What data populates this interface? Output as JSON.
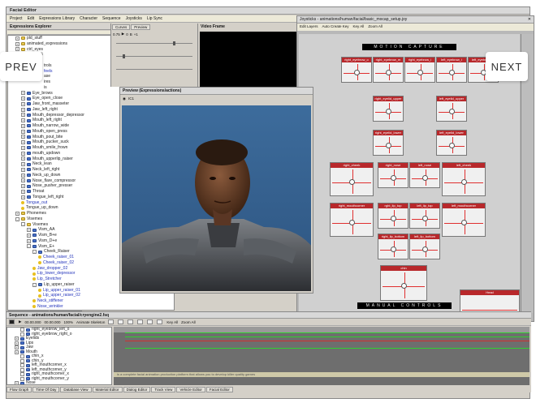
{
  "app": {
    "title": "Facial Editor",
    "menu": [
      "Project",
      "Edit",
      "Expressions Library",
      "Character",
      "Sequence",
      "Joysticks",
      "Lip Sync"
    ]
  },
  "explorer": {
    "title": "Expressions Explorer",
    "rows": [
      {
        "label": "pld_stuff",
        "indent": 1,
        "icon": "folder",
        "box": "+"
      },
      {
        "label": "animated_expressions",
        "indent": 1,
        "icon": "folder",
        "box": "+"
      },
      {
        "label": "ctrl_eyes",
        "indent": 1,
        "icon": "folder",
        "box": "+"
      },
      {
        "label": "ctrl_neck",
        "indent": 1,
        "icon": "folder",
        "box": "+"
      },
      {
        "label": "",
        "indent": 1,
        "icon": "none",
        "box": ""
      },
      {
        "label": "trols",
        "indent": 6,
        "icon": "none",
        "box": ""
      },
      {
        "label": "feels",
        "indent": 6,
        "icon": "none",
        "box": "",
        "link": true
      },
      {
        "label": "ase",
        "indent": 6,
        "icon": "none",
        "box": ""
      },
      {
        "label": "ires",
        "indent": 6,
        "icon": "none",
        "box": ""
      },
      {
        "label": "is",
        "indent": 6,
        "icon": "none",
        "box": ""
      },
      {
        "label": "Eye_brows",
        "indent": 2,
        "icon": "blue",
        "box": "+"
      },
      {
        "label": "Eye_open_close",
        "indent": 2,
        "icon": "blue",
        "box": "+"
      },
      {
        "label": "Jaw_front_masseter",
        "indent": 2,
        "icon": "blue",
        "box": "+"
      },
      {
        "label": "Jaw_left_right",
        "indent": 2,
        "icon": "blue",
        "box": "+"
      },
      {
        "label": "Mouth_depressor_depressor",
        "indent": 2,
        "icon": "blue",
        "box": "+"
      },
      {
        "label": "Mouth_left_right",
        "indent": 2,
        "icon": "blue",
        "box": "+"
      },
      {
        "label": "Mouth_narrow_wide",
        "indent": 2,
        "icon": "blue",
        "box": "+"
      },
      {
        "label": "Mouth_open_press",
        "indent": 2,
        "icon": "blue",
        "box": "+"
      },
      {
        "label": "Mouth_pout_bite",
        "indent": 2,
        "icon": "blue",
        "box": "+"
      },
      {
        "label": "Mouth_pucker_suck",
        "indent": 2,
        "icon": "blue",
        "box": "+"
      },
      {
        "label": "Mouth_smile_frown",
        "indent": 2,
        "icon": "blue",
        "box": "+"
      },
      {
        "label": "mouth_updown",
        "indent": 2,
        "icon": "blue",
        "box": "+"
      },
      {
        "label": "Mouth_upperlip_raiser",
        "indent": 2,
        "icon": "blue",
        "box": "+"
      },
      {
        "label": "Neck_lean",
        "indent": 2,
        "icon": "blue",
        "box": "+"
      },
      {
        "label": "Neck_left_right",
        "indent": 2,
        "icon": "blue",
        "box": "+"
      },
      {
        "label": "Neck_up_down",
        "indent": 2,
        "icon": "blue",
        "box": "+"
      },
      {
        "label": "Nose_flare_compressor",
        "indent": 2,
        "icon": "blue",
        "box": "+"
      },
      {
        "label": "Nose_pusher_presser",
        "indent": 2,
        "icon": "blue",
        "box": "+"
      },
      {
        "label": "Throat",
        "indent": 2,
        "icon": "blue",
        "box": "+"
      },
      {
        "label": "Tongue_left_right",
        "indent": 2,
        "icon": "blue",
        "box": "+"
      },
      {
        "label": "Tongue_out",
        "indent": 2,
        "icon": "dot",
        "box": "",
        "link": true
      },
      {
        "label": "Tongue_up_down",
        "indent": 2,
        "icon": "dot",
        "box": ""
      },
      {
        "label": "Phonemes",
        "indent": 1,
        "icon": "folder",
        "box": "+"
      },
      {
        "label": "Visemes",
        "indent": 1,
        "icon": "folder",
        "box": "-"
      },
      {
        "label": "Visemes",
        "indent": 2,
        "icon": "folder",
        "box": "-"
      },
      {
        "label": "Vism_AA",
        "indent": 3,
        "icon": "blue",
        "box": "+"
      },
      {
        "label": "Vism_B+e",
        "indent": 3,
        "icon": "blue",
        "box": "+"
      },
      {
        "label": "Vism_D+e",
        "indent": 3,
        "icon": "blue",
        "box": "+"
      },
      {
        "label": "Vism_E+",
        "indent": 3,
        "icon": "blue",
        "box": "-"
      },
      {
        "label": "Cheek_Raiser",
        "indent": 4,
        "icon": "blue",
        "box": "-"
      },
      {
        "label": "Cheek_raiser_01",
        "indent": 5,
        "icon": "dot",
        "box": "",
        "link": true
      },
      {
        "label": "Cheek_raiser_02",
        "indent": 5,
        "icon": "dot",
        "box": "",
        "link": true
      },
      {
        "label": "Jaw_dropper_02",
        "indent": 4,
        "icon": "dot",
        "box": "",
        "link": true
      },
      {
        "label": "Lip_lower_depressor",
        "indent": 4,
        "icon": "dot",
        "box": "",
        "link": true
      },
      {
        "label": "Lip_Stretcher",
        "indent": 4,
        "icon": "dot",
        "box": "",
        "link": true
      },
      {
        "label": "Lip_upper_raiser",
        "indent": 4,
        "icon": "blue",
        "box": "-"
      },
      {
        "label": "Lip_upper_raiser_01",
        "indent": 5,
        "icon": "dot",
        "box": "",
        "link": true
      },
      {
        "label": "Lip_upper_raiser_02",
        "indent": 5,
        "icon": "dot",
        "box": "",
        "link": true
      },
      {
        "label": "Neck_stiffener",
        "indent": 4,
        "icon": "dot",
        "box": "",
        "link": true
      },
      {
        "label": "Nose_wrinkler",
        "indent": 4,
        "icon": "dot",
        "box": "",
        "link": true
      },
      {
        "label": "Vism_F+V",
        "indent": 3,
        "icon": "blue",
        "box": "-"
      },
      {
        "label": "Fanial_drum",
        "indent": 4,
        "icon": "dot",
        "box": "",
        "link": true
      }
    ],
    "tabs": [
      "Expressions Explorer",
      "Effectors Sliders"
    ]
  },
  "curves": {
    "tabs": [
      "Curves",
      "Preview"
    ],
    "value": "0.75",
    "toolbar_buttons": [
      "0",
      "B",
      "+1"
    ]
  },
  "video": {
    "title": "Video Frame"
  },
  "preview": {
    "title": "Preview (Expressions/actions)",
    "toolbar": "IC1"
  },
  "joysticks": {
    "title": "Joysticks - animations/human/facial/basic_mocap_setup.joy",
    "menu": [
      "Edit Layers",
      "Auto Create Key",
      "Key All",
      "Zoom All"
    ],
    "motion_capture_label": "MOTION CAPTURE",
    "manual_controls_label": "MANUAL CONTROLS",
    "controls": [
      {
        "name": "right_eyebrow_o",
        "col": 0,
        "row": 0,
        "size": "s"
      },
      {
        "name": "right_eyebrow_m",
        "col": 1,
        "row": 0,
        "size": "s"
      },
      {
        "name": "right_eyebrow_i",
        "col": 2,
        "row": 0,
        "size": "s"
      },
      {
        "name": "left_eyebrow_i",
        "col": 3,
        "row": 0,
        "size": "s"
      },
      {
        "name": "left_eyebrow_m",
        "col": 4,
        "row": 0,
        "size": "s"
      },
      {
        "name": "right_eyelid_upper",
        "col": 1,
        "row": 1,
        "size": "s"
      },
      {
        "name": "left_eyelid_upper",
        "col": 3,
        "row": 1,
        "size": "s"
      },
      {
        "name": "right_eyelid_lower",
        "col": 1,
        "row": 2,
        "size": "s"
      },
      {
        "name": "left_eyelid_lower",
        "col": 3,
        "row": 2,
        "size": "s"
      },
      {
        "name": "right_cheek",
        "col": 0,
        "row": 3,
        "size": "l"
      },
      {
        "name": "right_nose",
        "col": 1,
        "row": 3,
        "size": "s"
      },
      {
        "name": "left_nose",
        "col": 2,
        "row": 3,
        "size": "s"
      },
      {
        "name": "left_cheek",
        "col": 3,
        "row": 3,
        "size": "l"
      },
      {
        "name": "rght_lip_top",
        "col": 1,
        "row": 4,
        "size": "s"
      },
      {
        "name": "left_lip_top",
        "col": 2,
        "row": 4,
        "size": "s"
      },
      {
        "name": "right_mouthcorner",
        "col": 0,
        "row": 4,
        "size": "l"
      },
      {
        "name": "left_mouthcorner",
        "col": 3,
        "row": 4,
        "size": "l"
      },
      {
        "name": "right_lip_bottom",
        "col": 1,
        "row": 5,
        "size": "s"
      },
      {
        "name": "left_lip_bottom",
        "col": 2,
        "row": 5,
        "size": "s"
      },
      {
        "name": "chin",
        "col": 1.5,
        "row": 6,
        "size": "m"
      }
    ],
    "head_label": "Head",
    "bottom_tabs": [
      "Mouth Position",
      "Pucker/Suck/Blow/Funnel/er",
      "None"
    ]
  },
  "sequence": {
    "title": "Sequence - animations/human/facial/cryengine2.fsq",
    "time_start": "00.00.000",
    "time_end": "00.00.000",
    "zoom": "100%",
    "animate_skeleton": "Animate Skeleton",
    "key_all": "Key All",
    "zoom_all": "Zoom All",
    "tracks": [
      {
        "label": "right_eyebrow_left_o",
        "indent": 2
      },
      {
        "label": "right_eyebrow_right_o",
        "indent": 2
      },
      {
        "label": "Eyelids",
        "indent": 1
      },
      {
        "label": "Lips",
        "indent": 1
      },
      {
        "label": "Jaw",
        "indent": 1
      },
      {
        "label": "Mouth",
        "indent": 1
      },
      {
        "label": "chin_x",
        "indent": 2
      },
      {
        "label": "chin_y",
        "indent": 2
      },
      {
        "label": "left_mouthcorner_x",
        "indent": 2
      },
      {
        "label": "left_mouthcorner_y",
        "indent": 2
      },
      {
        "label": "right_mouthcorner_x",
        "indent": 2
      },
      {
        "label": "right_mouthcorner_y",
        "indent": 2
      },
      {
        "label": "Nose",
        "indent": 1
      }
    ],
    "status_text": "is a complete facial animation production platform that allows you to develop killer quality games",
    "bottom_tabs": [
      "Flow Graph",
      "Time Of Day",
      "Database View",
      "Material Editor",
      "Dialog Editor",
      "Track View",
      "Vehicle Editor",
      "Facial Editor"
    ]
  },
  "nav": {
    "prev": "PREV",
    "next": "NEXT"
  },
  "colors": {
    "accent_red": "#b8282b",
    "panel": "#d4d0c8",
    "viewport": "#3d6c9c"
  }
}
